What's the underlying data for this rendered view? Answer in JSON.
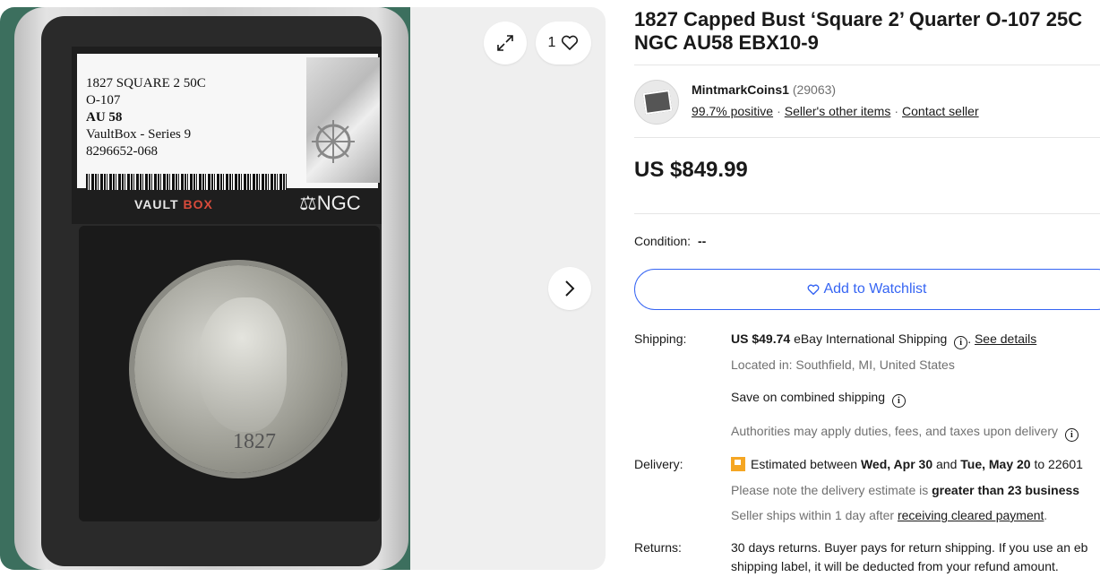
{
  "gallery": {
    "watch_count": "1",
    "slab_label": {
      "line1": "1827 SQUARE 2 50C",
      "line2": "O-107",
      "grade": "AU 58",
      "line4": "VaultBox - Series 9",
      "cert": "8296652-068"
    },
    "vaultbox_logo_a": "VAULT",
    "vaultbox_logo_b": "BOX",
    "ngc_logo": "NGC",
    "coin_date": "1827"
  },
  "listing": {
    "title": "1827 Capped Bust ‘Square 2’ Quarter O-107 25C\nNGC AU58 EBX10-9",
    "title_line1": "1827 Capped Bust ‘Square 2’ Quarter O-107 25C",
    "title_line2": "NGC AU58 EBX10-9",
    "price": "US $849.99",
    "condition_label": "Condition:",
    "condition_value": "--",
    "watchlist_label": "Add to Watchlist"
  },
  "seller": {
    "name": "MintmarkCoins1",
    "feedback_count": "(29063)",
    "positive": "99.7% positive",
    "other_items": "Seller's other items",
    "contact": "Contact seller"
  },
  "shipping": {
    "label": "Shipping:",
    "cost": "US $49.74",
    "method": "eBay International Shipping",
    "see_details": "See details",
    "location": "Located in: Southfield, MI, United States",
    "combined": "Save on combined shipping",
    "duties": "Authorities may apply duties, fees, and taxes upon delivery"
  },
  "delivery": {
    "label": "Delivery:",
    "prefix": "Estimated between",
    "start": "Wed, Apr 30",
    "and": "and",
    "end": "Tue, May 20",
    "to": "to 22601",
    "note_prefix": "Please note the delivery estimate is",
    "note_bold": "greater than 23 business",
    "ships_prefix": "Seller ships within 1 day after",
    "ships_link": "receiving cleared payment"
  },
  "returns": {
    "label": "Returns:",
    "line1": "30 days returns. Buyer pays for return shipping. If you use an eb",
    "line2": "shipping label, it will be deducted from your refund amount."
  },
  "colors": {
    "accent": "#3665f3",
    "muted": "#707070",
    "delivery_flag": "#f5a623"
  }
}
